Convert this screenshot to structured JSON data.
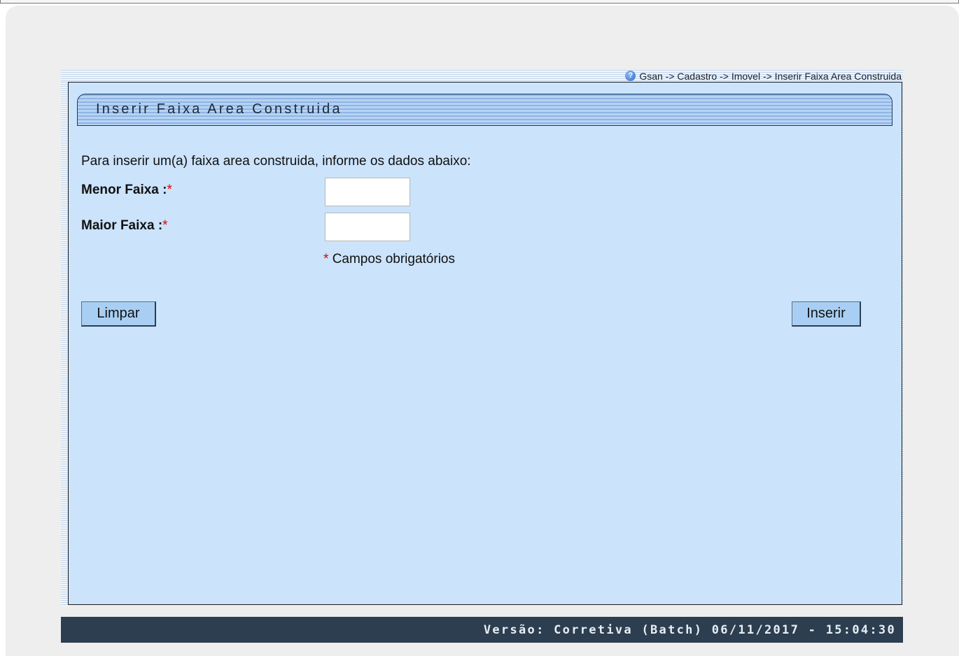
{
  "breadcrumb": {
    "text": "Gsan -> Cadastro -> Imovel -> Inserir Faixa Area Construida",
    "icon": "help-icon"
  },
  "panel": {
    "title": "Inserir Faixa Area Construida",
    "intro": "Para inserir um(a) faixa area construida, informe os dados abaixo:"
  },
  "form": {
    "menor_label": "Menor Faixa :",
    "menor_value": "",
    "maior_label": "Maior Faixa :",
    "maior_value": "",
    "required_marker": "*",
    "required_note": "Campos obrigatórios"
  },
  "buttons": {
    "limpar": "Limpar",
    "inserir": "Inserir"
  },
  "footer": {
    "version": "Versão: Corretiva (Batch) 06/11/2017 - 15:04:30"
  },
  "colors": {
    "panel_bg": "#cbe3fb",
    "footer_bg": "#2c3e50",
    "required": "#e00000",
    "button_bg": "#a8cff3"
  }
}
